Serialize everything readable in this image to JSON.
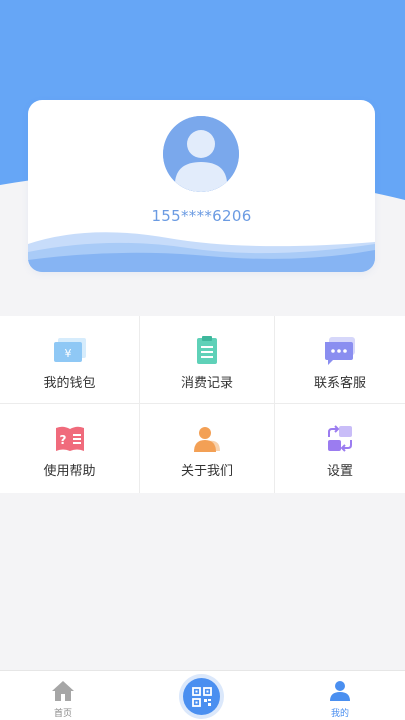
{
  "profile": {
    "phone": "155****6206",
    "avatar_icon": "user-avatar-icon"
  },
  "menu": [
    {
      "label": "我的钱包",
      "icon": "wallet-icon",
      "color": "#8fc8f5"
    },
    {
      "label": "消费记录",
      "icon": "receipt-icon",
      "color": "#5fd1b8"
    },
    {
      "label": "联系客服",
      "icon": "chat-bubble-icon",
      "color": "#8a8ef0"
    },
    {
      "label": "使用帮助",
      "icon": "help-book-icon",
      "color": "#f06b7c"
    },
    {
      "label": "关于我们",
      "icon": "about-user-icon",
      "color": "#f3a055"
    },
    {
      "label": "设置",
      "icon": "settings-swap-icon",
      "color": "#9b7cf0"
    }
  ],
  "tabbar": {
    "home_label": "首页",
    "mine_label": "我的",
    "scan_icon": "qr-scan-icon",
    "active_color": "#4a8ff0",
    "inactive_color": "#888888"
  },
  "theme": {
    "header_blue": "#66a6f6",
    "wave_light": "#c7dcfa",
    "wave_dark": "#86b4f3"
  }
}
